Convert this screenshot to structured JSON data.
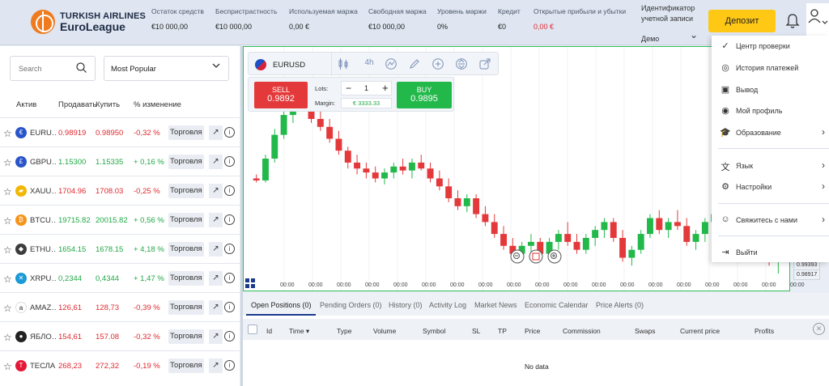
{
  "header": {
    "logo_line1": "TURKISH AIRLINES",
    "logo_line2": "EuroLeague",
    "stats": [
      {
        "label": "Остаток средств",
        "value": "€10 000,00",
        "color": "default"
      },
      {
        "label": "Беспристрастность",
        "value": "€10 000,00",
        "color": "default"
      },
      {
        "label": "Используемая маржа",
        "value": "0,00 €",
        "color": "default"
      },
      {
        "label": "Свободная маржа",
        "value": "€10 000,00",
        "color": "default"
      },
      {
        "label": "Уровень маржи",
        "value": "0%",
        "color": "default"
      },
      {
        "label": "Кредит",
        "value": "€0",
        "color": "default"
      },
      {
        "label": "Открытые прибыли и убытки",
        "value": "0,00 €",
        "color": "red"
      }
    ],
    "account_label_line1": "Идентификатор",
    "account_label_line2": "учетной записи",
    "account_type": "Демо",
    "deposit_label": "Депозит",
    "bell_icon": "bell-icon",
    "user_icon": "user-icon"
  },
  "sidebar": {
    "search_placeholder": "Search",
    "filter_selected": "Most Popular",
    "columns": {
      "asset": "Актив",
      "sell": "Продавать",
      "buy": "Купить",
      "change": "% изменение"
    },
    "trade_label": "Торговля",
    "rows": [
      {
        "name": "EURU…",
        "sell": "0.98919",
        "buy": "0.98950",
        "change": "-0,32 %",
        "dir": "down",
        "icon": "eur-usd-flag-icon",
        "icon_color": "#2a55c9",
        "icon_char": "€"
      },
      {
        "name": "GBPU…",
        "sell": "1.15300",
        "buy": "1.15335",
        "change": "+ 0,16 %",
        "dir": "up",
        "icon": "gbp-usd-flag-icon",
        "icon_color": "#2a55c9",
        "icon_char": "£"
      },
      {
        "name": "XAUU…",
        "sell": "1704.96",
        "buy": "1708.03",
        "change": "-0,25 %",
        "dir": "down",
        "icon": "gold-icon",
        "icon_color": "#f2b705",
        "icon_char": "▰"
      },
      {
        "name": "BTCU…",
        "sell": "19715.82",
        "buy": "20015.82",
        "change": "+ 0,56 %",
        "dir": "up",
        "icon": "bitcoin-icon",
        "icon_color": "#f7931a",
        "icon_char": "₿"
      },
      {
        "name": "ETHU…",
        "sell": "1654.15",
        "buy": "1678.15",
        "change": "+ 4,18 %",
        "dir": "up",
        "icon": "ethereum-icon",
        "icon_color": "#3c3c3d",
        "icon_char": "◆"
      },
      {
        "name": "XRPU…",
        "sell": "0,2344",
        "buy": "0,4344",
        "change": "+ 1,47 %",
        "dir": "up",
        "icon": "xrp-icon",
        "icon_color": "#1a9ad6",
        "icon_char": "✕"
      },
      {
        "name": "AMAZ…",
        "sell": "126,61",
        "buy": "128,73",
        "change": "-0,39 %",
        "dir": "down",
        "icon": "amazon-icon",
        "icon_color": "#ffffff",
        "icon_char": "a"
      },
      {
        "name": "ЯБЛО…",
        "sell": "154,61",
        "buy": "157.08",
        "change": "-0,32 %",
        "dir": "down",
        "icon": "apple-icon",
        "icon_color": "#222222",
        "icon_char": "●"
      },
      {
        "name": "ТЕСЛА",
        "sell": "268,23",
        "buy": "272,32",
        "change": "-0,19 %",
        "dir": "down",
        "icon": "tesla-icon",
        "icon_color": "#e31937",
        "icon_char": "T"
      }
    ]
  },
  "chart_toolbar": {
    "symbol": "EURUSD",
    "timeframe": "4h"
  },
  "trade_panel": {
    "sell_label": "SELL",
    "sell_price": "0.9892",
    "buy_label": "BUY",
    "buy_price": "0.9895",
    "lots_label": "Lots:",
    "lots_value": "1",
    "margin_label": "Margin:",
    "margin_value": "€ 3333.33"
  },
  "chart": {
    "time_tick_label": "00:00",
    "y_labels": [
      "0.99393",
      "0.98917"
    ],
    "colors": {
      "up": "#22b84a",
      "down": "#e4393a"
    }
  },
  "chart_data": {
    "type": "candlestick",
    "symbol": "EURUSD",
    "timeframe": "4h",
    "candles": [
      [
        0.5,
        0.52,
        0.48,
        0.49
      ],
      [
        0.49,
        0.62,
        0.48,
        0.6
      ],
      [
        0.6,
        0.75,
        0.58,
        0.72
      ],
      [
        0.72,
        0.85,
        0.7,
        0.82
      ],
      [
        0.82,
        0.92,
        0.78,
        0.88
      ],
      [
        0.88,
        0.95,
        0.84,
        0.9
      ],
      [
        0.9,
        0.92,
        0.78,
        0.8
      ],
      [
        0.8,
        0.84,
        0.74,
        0.76
      ],
      [
        0.76,
        0.8,
        0.68,
        0.7
      ],
      [
        0.7,
        0.74,
        0.62,
        0.64
      ],
      [
        0.64,
        0.66,
        0.55,
        0.58
      ],
      [
        0.58,
        0.62,
        0.52,
        0.55
      ],
      [
        0.55,
        0.58,
        0.5,
        0.53
      ],
      [
        0.53,
        0.56,
        0.48,
        0.5
      ],
      [
        0.5,
        0.55,
        0.47,
        0.53
      ],
      [
        0.53,
        0.58,
        0.5,
        0.56
      ],
      [
        0.56,
        0.6,
        0.52,
        0.54
      ],
      [
        0.54,
        0.6,
        0.5,
        0.58
      ],
      [
        0.58,
        0.62,
        0.54,
        0.55
      ],
      [
        0.55,
        0.58,
        0.48,
        0.5
      ],
      [
        0.5,
        0.54,
        0.44,
        0.46
      ],
      [
        0.46,
        0.5,
        0.38,
        0.4
      ],
      [
        0.4,
        0.44,
        0.34,
        0.36
      ],
      [
        0.36,
        0.42,
        0.33,
        0.4
      ],
      [
        0.4,
        0.42,
        0.3,
        0.32
      ],
      [
        0.32,
        0.36,
        0.26,
        0.28
      ],
      [
        0.28,
        0.32,
        0.2,
        0.22
      ],
      [
        0.22,
        0.26,
        0.14,
        0.16
      ],
      [
        0.16,
        0.2,
        0.1,
        0.12
      ],
      [
        0.12,
        0.18,
        0.1,
        0.16
      ],
      [
        0.16,
        0.22,
        0.12,
        0.18
      ],
      [
        0.18,
        0.2,
        0.1,
        0.12
      ],
      [
        0.12,
        0.2,
        0.1,
        0.18
      ],
      [
        0.18,
        0.24,
        0.14,
        0.22
      ],
      [
        0.22,
        0.28,
        0.16,
        0.18
      ],
      [
        0.18,
        0.22,
        0.12,
        0.14
      ],
      [
        0.14,
        0.22,
        0.12,
        0.2
      ],
      [
        0.2,
        0.26,
        0.16,
        0.24
      ],
      [
        0.24,
        0.3,
        0.2,
        0.28
      ],
      [
        0.28,
        0.3,
        0.18,
        0.2
      ],
      [
        0.2,
        0.24,
        0.08,
        0.1
      ],
      [
        0.1,
        0.16,
        0.06,
        0.14
      ],
      [
        0.14,
        0.24,
        0.12,
        0.22
      ],
      [
        0.22,
        0.32,
        0.2,
        0.3
      ],
      [
        0.3,
        0.34,
        0.22,
        0.24
      ],
      [
        0.24,
        0.3,
        0.2,
        0.28
      ],
      [
        0.28,
        0.34,
        0.24,
        0.26
      ],
      [
        0.26,
        0.3,
        0.16,
        0.18
      ],
      [
        0.18,
        0.24,
        0.14,
        0.22
      ],
      [
        0.22,
        0.3,
        0.18,
        0.28
      ],
      [
        0.28,
        0.34,
        0.24,
        0.32
      ],
      [
        0.32,
        0.36,
        0.26,
        0.28
      ],
      [
        0.28,
        0.3,
        0.18,
        0.2
      ],
      [
        0.2,
        0.28,
        0.16,
        0.26
      ],
      [
        0.26,
        0.32,
        0.2,
        0.3
      ],
      [
        0.3,
        0.34,
        0.18,
        0.2
      ],
      [
        0.2,
        0.22,
        0.06,
        0.08
      ],
      [
        0.08,
        0.14,
        0.02,
        0.12
      ]
    ]
  },
  "bottom": {
    "tabs": [
      "Open Positions (0)",
      "Pending Orders (0)",
      "History (0)",
      "Activity Log",
      "Market News",
      "Economic Calendar",
      "Price Alerts (0)"
    ],
    "columns": [
      "Id",
      "Time ▾",
      "Type",
      "Volume",
      "Symbol",
      "SL",
      "TP",
      "Price",
      "Commission",
      "Swaps",
      "Current price",
      "Profits"
    ],
    "empty_text": "No data"
  },
  "user_menu": {
    "items": [
      {
        "label": "Центр проверки",
        "icon": "check-circle-icon",
        "glyph": "✓",
        "arrow": false
      },
      {
        "label": "История платежей",
        "icon": "payment-history-icon",
        "glyph": "◎",
        "arrow": false
      },
      {
        "label": "Вывод",
        "icon": "withdraw-icon",
        "glyph": "▣",
        "arrow": false
      },
      {
        "label": "Мой профиль",
        "icon": "profile-icon",
        "glyph": "◉",
        "arrow": false
      },
      {
        "label": "Образование",
        "icon": "education-icon",
        "glyph": "🎓",
        "arrow": true
      },
      {
        "label": "Язык",
        "icon": "language-icon",
        "glyph": "文",
        "arrow": true
      },
      {
        "label": "Настройки",
        "icon": "settings-icon",
        "glyph": "⚙",
        "arrow": true
      },
      {
        "label": "Свяжитесь с нами",
        "icon": "contact-icon",
        "glyph": "☺",
        "arrow": true
      },
      {
        "label": "Выйти",
        "icon": "logout-icon",
        "glyph": "⇥",
        "arrow": false
      }
    ]
  }
}
